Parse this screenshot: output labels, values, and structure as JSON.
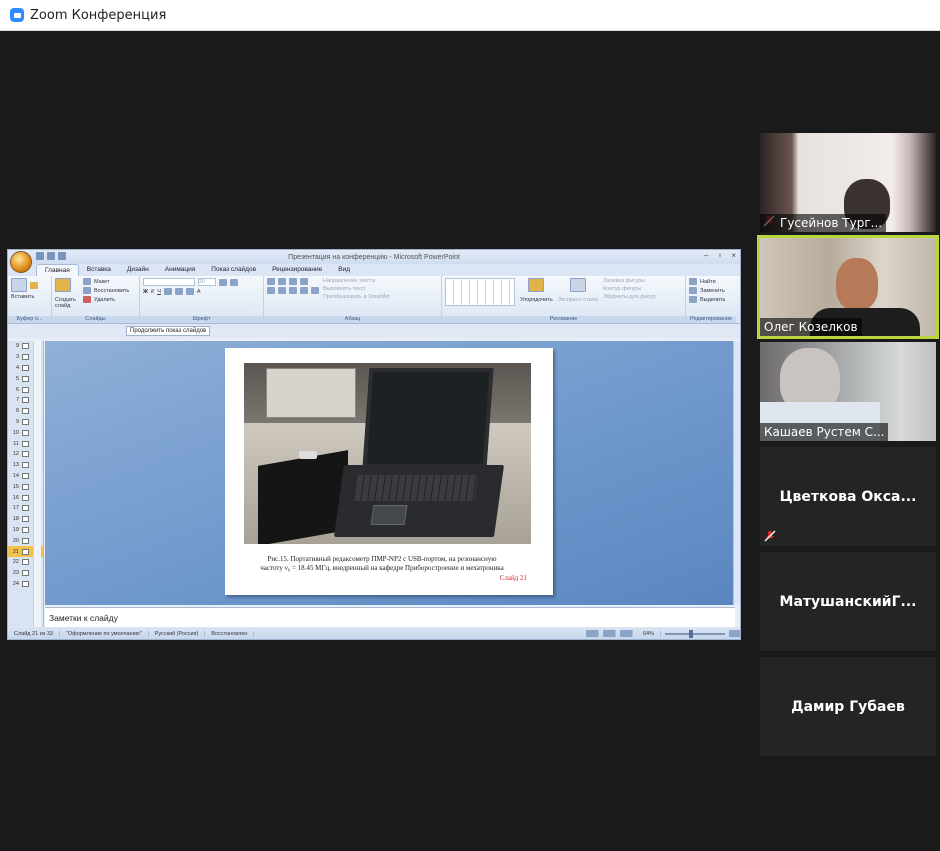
{
  "app": {
    "title": "Zoom Конференция"
  },
  "powerpoint": {
    "title": "Презентация на конференцию - Microsoft PowerPoint",
    "tabs": [
      "Главная",
      "Вставка",
      "Дизайн",
      "Анимация",
      "Показ слайдов",
      "Рецензирование",
      "Вид"
    ],
    "active_tab": "Главная",
    "ribbon": {
      "clipboard": {
        "paste": "Вставить",
        "label": "Буфер о..."
      },
      "slides": {
        "create": "Создать слайд",
        "layout": "Макет",
        "reset": "Восстановить",
        "delete": "Удалить",
        "label": "Слайды"
      },
      "font": {
        "size": "20",
        "label": "Шрифт"
      },
      "paragraph": {
        "text_direction": "Направление текста",
        "align_text": "Выровнять текст",
        "smartart": "Преобразовать в SmartArt",
        "label": "Абзац"
      },
      "drawing": {
        "arrange": "Упорядочить",
        "quick_styles": "Экспресс-стили",
        "fill": "Заливка фигуры",
        "outline": "Контур фигуры",
        "effects": "Эффекты для фигур",
        "label": "Рисование"
      },
      "editing": {
        "find": "Найти",
        "replace": "Заменить",
        "select": "Выделить",
        "label": "Редактирование"
      }
    },
    "continue_show_button": "Продолжить показ слайдов",
    "slide_numbers": [
      "9",
      "3",
      "4",
      "5",
      "6",
      "7",
      "8",
      "9",
      "10",
      "11",
      "12",
      "13",
      "14",
      "15",
      "16",
      "17",
      "18",
      "19",
      "20",
      "21",
      "22",
      "23",
      "24"
    ],
    "selected_slide": "21",
    "slide": {
      "caption_line1": "Рис.15. Портативный редаксометр ПМР-NP2 с USB-портом, на резонансную",
      "caption_line2": "частоту ν₀ = 18.45 МГц, внедренный на кафедре Приборостроение и мехатроника",
      "slide_label": "Слайд 21"
    },
    "notes_placeholder": "Заметки к слайду",
    "status": {
      "slide_counter": "Слайд 21 из 33",
      "theme": "\"Оформление по умолчанию\"",
      "language": "Русский (Россия)",
      "state": "Восстановлен",
      "zoom": "64%"
    }
  },
  "participants": [
    {
      "name": "Гусейнов Тург...",
      "muted": true,
      "video": true
    },
    {
      "name": "Олег Козелков",
      "muted": false,
      "video": true,
      "active_speaker": true
    },
    {
      "name": "Кашаев Рустем С...",
      "muted": false,
      "video": true
    },
    {
      "name": "Цветкова  Окса...",
      "muted": true,
      "video": false
    },
    {
      "name": "МатушанскийГ...",
      "muted": false,
      "video": false
    },
    {
      "name": "Дамир Губаев",
      "muted": false,
      "video": false
    }
  ],
  "colors": {
    "active_speaker_border": "#b9d63c",
    "zoom_blue": "#2d8cff",
    "mute_red": "#e02828"
  },
  "icons": [
    "zoom-logo-icon",
    "office-orb-icon",
    "mic-muted-icon"
  ]
}
